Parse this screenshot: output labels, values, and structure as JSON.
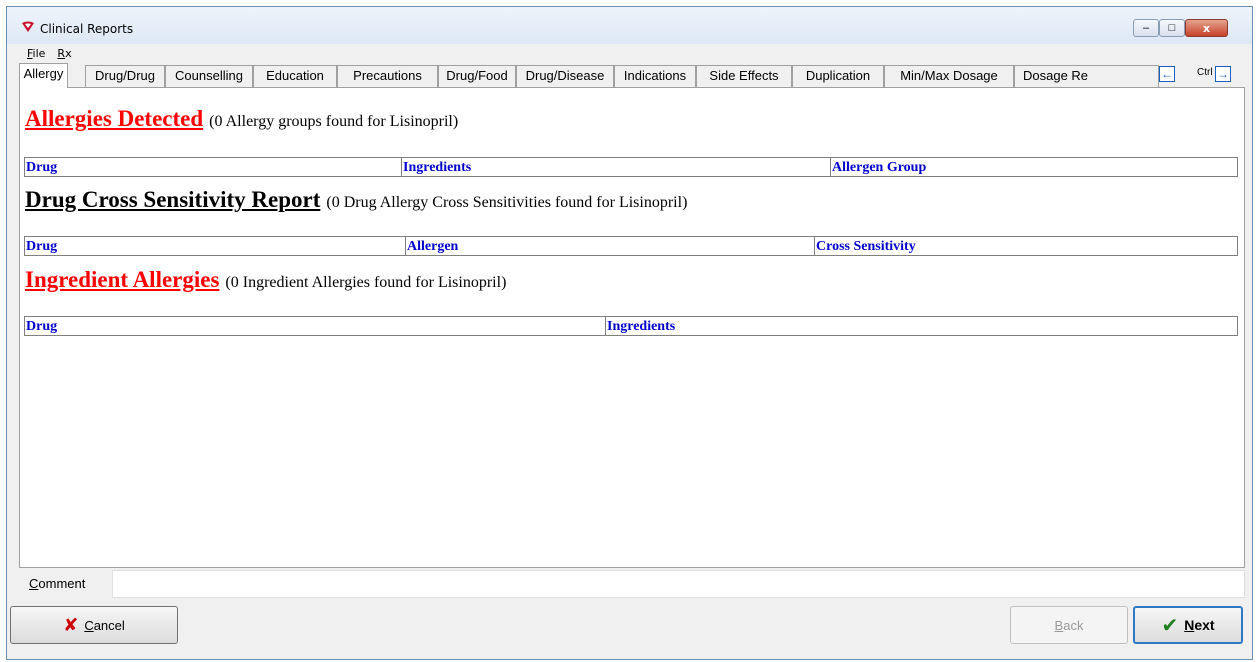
{
  "window": {
    "title": "Clinical Reports",
    "minimize_label": "–",
    "maximize_label": "□",
    "close_label": "x"
  },
  "menu": [
    "File",
    "Rx"
  ],
  "tabs": [
    "Allergy",
    "Drug/Drug",
    "Counselling",
    "Education",
    "Precautions",
    "Drug/Food",
    "Drug/Disease",
    "Indications",
    "Side Effects",
    "Duplication",
    "Min/Max Dosage",
    "Dosage Re"
  ],
  "active_tab": "Allergy",
  "tab_nav": {
    "left_arrow": "←",
    "ctrl_label": "Ctrl",
    "right_arrow": "→"
  },
  "sections": {
    "allergies": {
      "title": "Allergies Detected",
      "note": "(0 Allergy groups found for Lisinopril)",
      "columns": [
        "Drug",
        "Ingredients",
        "Allergen Group"
      ]
    },
    "cross_sensitivity": {
      "title": "Drug Cross Sensitivity Report",
      "note": "(0 Drug Allergy Cross Sensitivities found for Lisinopril)",
      "columns": [
        "Drug",
        "Allergen",
        "Cross Sensitivity"
      ]
    },
    "ingredient_allergies": {
      "title": "Ingredient Allergies",
      "note": "(0 Ingredient Allergies found for Lisinopril)",
      "columns": [
        "Drug",
        "Ingredients"
      ]
    }
  },
  "comment": {
    "label": "Comment",
    "value": ""
  },
  "buttons": {
    "cancel": "Cancel",
    "back": "Back",
    "next": "Next"
  },
  "colors": {
    "heading_red": "#ff0000",
    "column_blue": "#0000cc",
    "next_border": "#2f79c4"
  }
}
